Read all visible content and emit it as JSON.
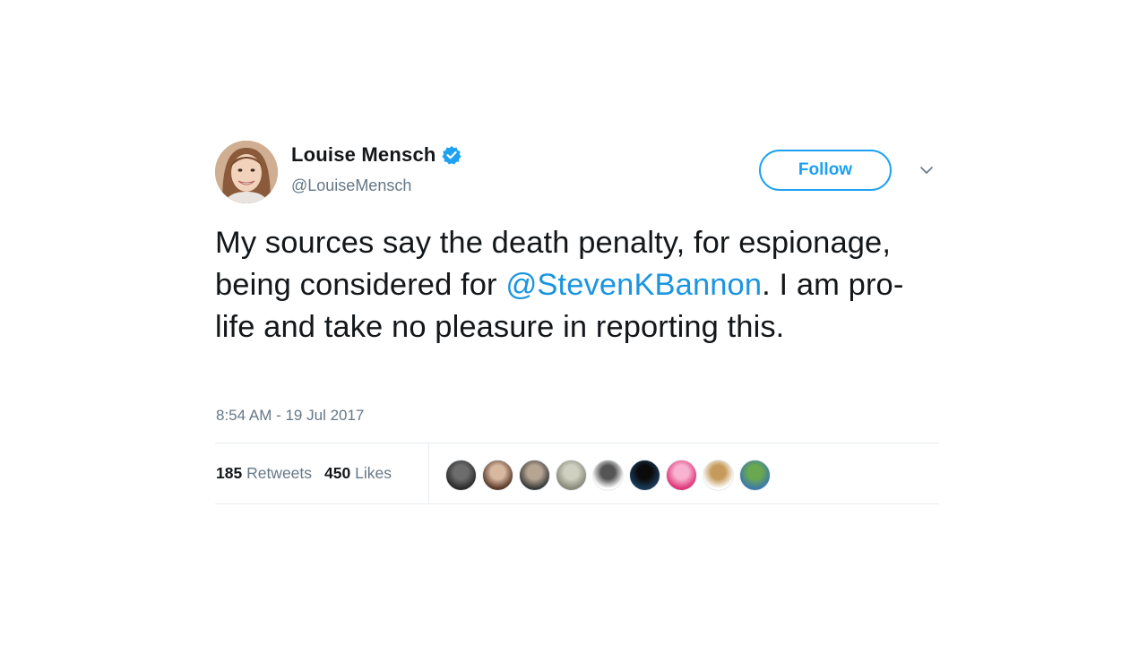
{
  "tweet": {
    "name": "Louise Mensch",
    "handle": "@LouiseMensch",
    "follow_label": "Follow",
    "text_part1": "My sources say the death penalty, for espionage, being considered for ",
    "mention": "@StevenKBannon",
    "text_part2": ". I am pro-life and take no pleasure in reporting this.",
    "timestamp": "8:54 AM - 19 Jul 2017",
    "retweets_count": "185",
    "retweets_label": "Retweets",
    "likes_count": "450",
    "likes_label": "Likes"
  },
  "colors": {
    "accent": "#1da1f2",
    "mention": "#1b95e0",
    "secondary_text": "#657786"
  },
  "icons": {
    "verified": "verified-badge-icon",
    "chevron": "chevron-down-icon"
  },
  "likers": [
    {
      "color_a": "#2b2b2b",
      "color_b": "#6d6d6d"
    },
    {
      "color_a": "#5b3b2a",
      "color_b": "#d9b8a0"
    },
    {
      "color_a": "#3b3b3b",
      "color_b": "#b7a593"
    },
    {
      "color_a": "#8a8a7a",
      "color_b": "#d0d0c0"
    },
    {
      "color_a": "#ffffff",
      "color_b": "#555555"
    },
    {
      "color_a": "#1b3b5a",
      "color_b": "#0b0b0b"
    },
    {
      "color_a": "#e0357a",
      "color_b": "#f7b3cf"
    },
    {
      "color_a": "#ffffff",
      "color_b": "#c59a5a"
    },
    {
      "color_a": "#3d7aa8",
      "color_b": "#6aa84f"
    }
  ]
}
